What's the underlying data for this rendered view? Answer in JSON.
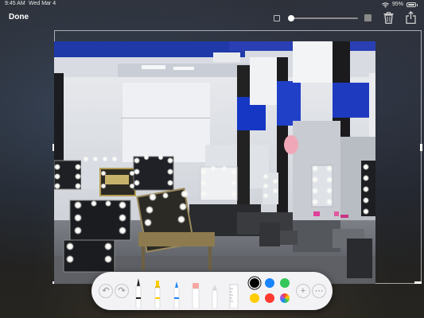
{
  "status_bar": {
    "time": "9:45 AM",
    "date": "Wed Mar 4",
    "battery": "95%",
    "icons": [
      "wifi-icon",
      "battery-icon"
    ]
  },
  "toolbar": {
    "done_label": "Done",
    "line_width_slider_value": 0.0,
    "icons": [
      "small-square-icon",
      "large-square-icon",
      "trash-icon",
      "share-icon"
    ]
  },
  "photo": {
    "description_icon": "makeup-studio-photo"
  },
  "markup_palette": {
    "buttons": [
      "undo-icon",
      "redo-icon",
      "pen-tool-icon",
      "highlighter-tool-icon",
      "pencil-tool-icon",
      "eraser-tool-icon",
      "lasso-tool-icon",
      "ruler-tool-icon",
      "plus-icon",
      "more-icon"
    ],
    "colors": [
      {
        "name": "black",
        "hex": "#000000",
        "selected": true
      },
      {
        "name": "blue",
        "hex": "#1a84ff",
        "selected": false
      },
      {
        "name": "green",
        "hex": "#34c759",
        "selected": false
      },
      {
        "name": "yellow",
        "hex": "#ffcc00",
        "selected": false
      },
      {
        "name": "red",
        "hex": "#ff3b30",
        "selected": false
      },
      {
        "name": "multicolor",
        "hex": "#c080ff",
        "selected": false
      }
    ]
  }
}
